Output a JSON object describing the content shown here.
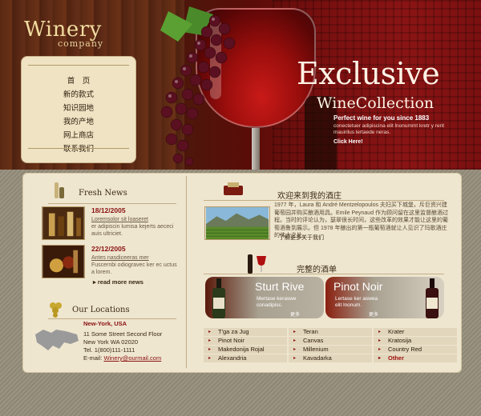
{
  "brand": {
    "logo_main": "Winery",
    "logo_sub": "company"
  },
  "nav": {
    "items": [
      "首　页",
      "新的款式",
      "知识园地",
      "我的产地",
      "网上商店",
      "联系我们"
    ]
  },
  "banner": {
    "headline1": "Exclusive",
    "headline2": "WineCollection",
    "tagline": "Perfect wine for you since 1883",
    "description": "conectetuer adipiscina elit lnonummt kretr y rerit mauirilus lertaede neras.",
    "cta": "Click Here!"
  },
  "fresh_news": {
    "title": "Fresh News",
    "items": [
      {
        "date": "18/12/2005",
        "link": "Loremsolor sit loaseret",
        "text": "er adipiscin lumisa kejerts aececi auis ultriciet."
      },
      {
        "date": "22/12/2005",
        "link": "Antes nasdiceeras mer",
        "text": "Fuscernbi odiogravec ker ec uctus a lorem."
      }
    ],
    "read_more": "read more news"
  },
  "locations": {
    "title": "Our Locations",
    "city": "New-York, USA",
    "address1": "11 Some Street Second Floor",
    "address2": "New York WA 02020",
    "tel": "Tel.  1(800)111-1111",
    "email_label": "E-mail:",
    "email": "Winery@ourmail.com"
  },
  "welcome": {
    "title": "欢迎来到我的酒庄",
    "text": "1977 年，Laura 和 André Mentzelopoulos 夫妇买下城堡，斥巨资兴建葡萄园并购买酿酒用具。Emile Peynaud 作为顾问留在这里监督酿酒过程。当时的评论认为，瑟翠很长时间，这些改革的效果才能让这里的葡萄酒鲁到展示。但 1978 年酿出的第一瓶葡萄酒就让人见识了玛歌酒庄的伟大之处。",
    "more": "了解更多关于我们"
  },
  "wine_list": {
    "title": "完整的酒单",
    "promos": [
      {
        "name": "Sturt Rive",
        "desc1": "Mertase keraswe",
        "desc2": "conadipisc.",
        "more": "更多"
      },
      {
        "name": "Pinot Noir",
        "desc1": "Lertase ker aswea",
        "desc2": "elit lnonum.",
        "more": "更多"
      }
    ],
    "columns": [
      [
        "T'ga za Jug",
        "Pinot Noir",
        "Makedonija Rojal",
        "Alexandria"
      ],
      [
        "Teran",
        "Canvas",
        "Millenium",
        "Kavadarka"
      ],
      [
        "Krater",
        "Kratosija",
        "Country Red",
        "Other"
      ]
    ]
  },
  "colors": {
    "accent": "#8a1010",
    "panel": "#efe6d0",
    "banner_red": "#7a1010"
  }
}
